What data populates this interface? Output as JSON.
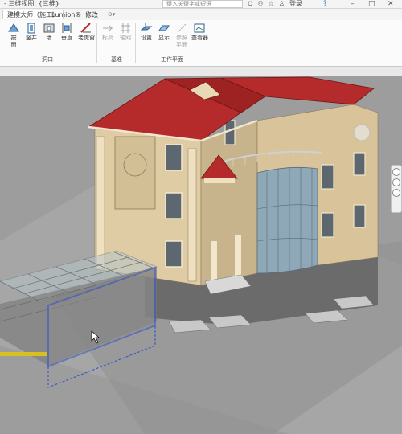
{
  "titlebar": {
    "title": "- 三维视图: {三维}",
    "search_placeholder": "键入关键字或短语",
    "login": "登录",
    "icons": [
      "binoculars-icon",
      "user-icon",
      "star-icon",
      "account-icon",
      "help-icon"
    ]
  },
  "tabs": [
    "建模大师（施工）",
    "Lumion®",
    "修改"
  ],
  "active_tab": 0,
  "ribbon": {
    "buttons": [
      {
        "label": "按\n面",
        "icon": "by-face-icon",
        "enabled": true
      },
      {
        "label": "竖井",
        "icon": "shaft-icon",
        "enabled": true
      },
      {
        "label": "墙",
        "icon": "wall-opening-icon",
        "enabled": true
      },
      {
        "label": "垂直",
        "icon": "vertical-icon",
        "enabled": true
      },
      {
        "label": "老虎窗",
        "icon": "dormer-icon",
        "enabled": true
      },
      {
        "label": "标高",
        "icon": "level-icon",
        "enabled": false
      },
      {
        "label": "轴网",
        "icon": "grid-icon",
        "enabled": false
      },
      {
        "label": "设置",
        "icon": "set-plane-icon",
        "enabled": true
      },
      {
        "label": "显示",
        "icon": "show-plane-icon",
        "enabled": true
      },
      {
        "label": "参照\n平面",
        "icon": "ref-plane-icon",
        "enabled": false
      },
      {
        "label": "查看器",
        "icon": "viewer-icon",
        "enabled": true
      }
    ],
    "panels": [
      "洞口",
      "基准",
      "工作平面"
    ]
  },
  "viewport": {
    "close_label": "×"
  },
  "colors": {
    "roof": "#b52a2a",
    "wall": "#e2cfa8",
    "glass": "#8fa8b8",
    "ground": "#a3a3a3",
    "selection": "#2a4fd0"
  }
}
